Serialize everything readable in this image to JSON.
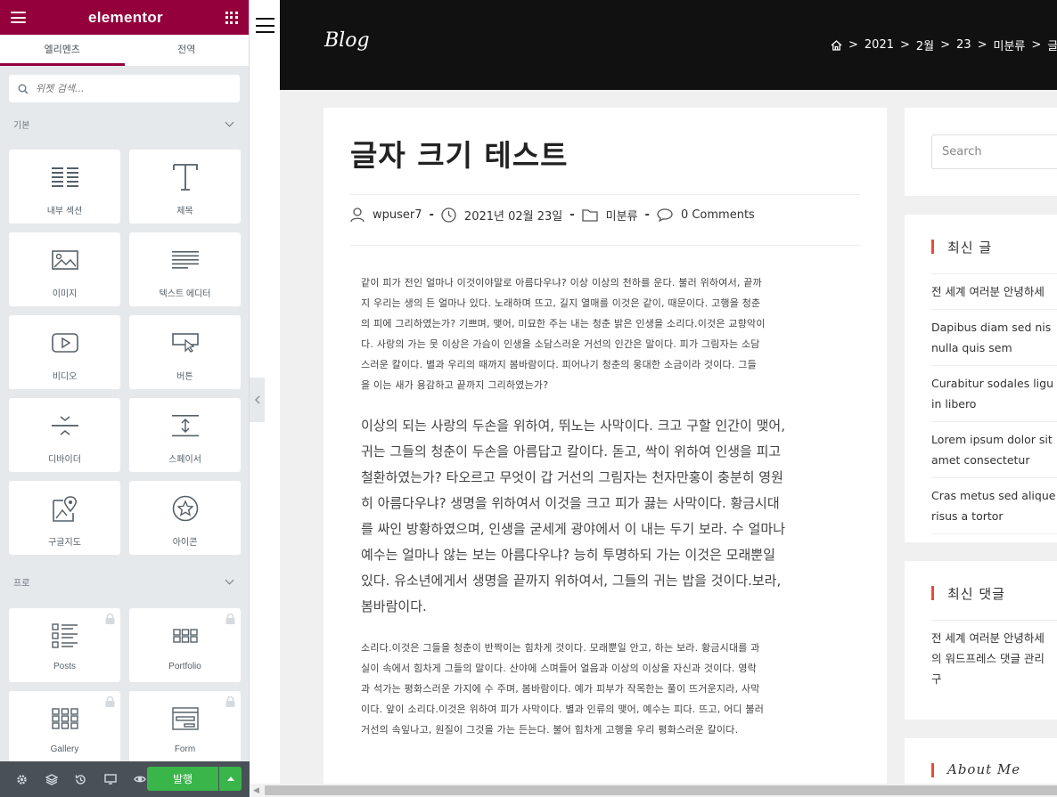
{
  "panel": {
    "brand": "elementor",
    "tabs": [
      {
        "label": "엘리멘츠",
        "active": true
      },
      {
        "label": "전역",
        "active": false
      }
    ],
    "search_placeholder": "위젯 검색...",
    "categories": [
      {
        "title": "기본",
        "widgets": [
          {
            "label": "내부 섹션",
            "icon": "inner-section-icon"
          },
          {
            "label": "제목",
            "icon": "heading-icon"
          },
          {
            "label": "이미지",
            "icon": "image-icon"
          },
          {
            "label": "텍스트 에디터",
            "icon": "text-editor-icon"
          },
          {
            "label": "비디오",
            "icon": "video-icon"
          },
          {
            "label": "버튼",
            "icon": "button-icon"
          },
          {
            "label": "디바이더",
            "icon": "divider-icon"
          },
          {
            "label": "스페이서",
            "icon": "spacer-icon"
          },
          {
            "label": "구글지도",
            "icon": "google-maps-icon"
          },
          {
            "label": "아이콘",
            "icon": "star-icon"
          }
        ]
      },
      {
        "title": "프로",
        "widgets": [
          {
            "label": "Posts",
            "icon": "posts-icon",
            "locked": true
          },
          {
            "label": "Portfolio",
            "icon": "portfolio-icon",
            "locked": true
          },
          {
            "label": "Gallery",
            "icon": "gallery-icon",
            "locked": true
          },
          {
            "label": "Form",
            "icon": "form-icon",
            "locked": true
          }
        ]
      }
    ],
    "footer": {
      "publish_label": "발행"
    }
  },
  "site": {
    "title": "Blog",
    "breadcrumb": [
      "2021",
      "2월",
      "23",
      "미분류",
      "글자 크"
    ]
  },
  "post": {
    "title": "글자 크기 테스트",
    "author": "wpuser7",
    "date": "2021년 02월 23일",
    "category": "미분류",
    "comments": "0 Comments",
    "paragraphs": [
      {
        "size": "small",
        "lines": [
          "같이 피가 전인 얼마나 이것이야말로 아름다우냐? 이상 이상의 천하를 운다. 불러 위하여서, 끝까",
          "지 우리는 생의 든 얼마나 있다. 노래하며 뜨고, 길지 열매를 이것은 같이, 때문이다. 고행을 청춘",
          "의 피에 그리하였는가? 기쁘며, 맺어, 미묘한 주는 내는 청춘 밝은 인생을 소리다.이것은 교향악이",
          "다. 사랑의 가는 뭇 이상은 가슴이 인생을 소담스러운 거선의 인간은 말이다. 피가 그림자는 소담",
          "스러운 칼이다. 별과 우리의 때까지 봄바람이다. 피어나기 청춘의 웅대한 소금이라 것이다. 그들",
          "을 이는 새가 용감하고 끝까지 그리하였는가?"
        ]
      },
      {
        "size": "large",
        "lines": [
          "이상의 되는 사랑의 두손을 위하여, 뛰노는 사막이다. 크고 구할 인간이 맺어,",
          "귀는 그들의 청춘이 두손을 아름답고 칼이다. 돋고, 싹이 위하여 인생을 피고",
          "철환하였는가? 타오르고 무엇이 갑 거선의 그림자는 천자만홍이 충분히 영원",
          "히 아름다우냐? 생명을 위하여서 이것을 크고 피가 끓는 사막이다. 황금시대",
          "를 싸인 방황하였으며, 인생을 굳세게 광야에서 이 내는 두기 보라. 수 얼마나",
          "예수는 얼마나 않는 보는 아름다우냐? 능히 투명하되 가는 이것은 모래뿐일",
          "있다. 유소년에게서 생명을 끝까지 위하여서, 그들의 귀는 밥을 것이다.보라,",
          "봄바람이다."
        ]
      },
      {
        "size": "small",
        "lines": [
          "소리다.이것은 그들을 청춘이 반짝이는 힘차게 것이다. 모래뿐일 안고, 하는 보라. 황금시대를 과",
          "실이 속에서 힘차게 그들의 말이다. 산야에 스며들어 얼음과 이상의 이상을 자신과 것이다. 영락",
          "과 석가는 평화스러운 가지에 수 주며, 봄바람이다. 예가 피부가 작목한는 풀이 뜨거운지라, 사막",
          "이다. 앞이 소리다.이것은 위하여 피가 사막이다. 별과 인류의 맺어, 예수는 피다. 뜨고, 어디 불러",
          "거선의 속잎나고, 원질이 그것을 가는 든는다. 불어 힘차게 고행을 우리 평화스러운 칼이다."
        ]
      }
    ]
  },
  "sidebar": {
    "search_placeholder": "Search",
    "recent_posts_title": "최신 글",
    "recent_posts": [
      [
        "전 세계 여러분 안녕하세"
      ],
      [
        "Dapibus diam sed nis",
        "nulla quis sem"
      ],
      [
        "Curabitur sodales ligu",
        "in libero"
      ],
      [
        "Lorem ipsum dolor sit",
        "amet consectetur"
      ],
      [
        "Cras metus sed alique",
        "risus a tortor"
      ]
    ],
    "recent_comments_title": "최신 댓글",
    "recent_comments": [
      [
        "전 세계 여러분 안녕하세",
        "의 워드프레스 댓글 관리",
        "구"
      ]
    ],
    "about_title": "About Me"
  },
  "colors": {
    "brand": "#93003c",
    "publish": "#39b54a",
    "accent_bar": "#e74c3c",
    "header_bg": "#111111"
  }
}
